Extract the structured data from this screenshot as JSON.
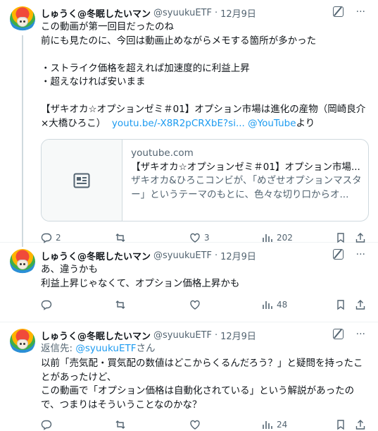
{
  "tweets": [
    {
      "name": "しゅうく@冬眠したいマン",
      "handle": "@syuukuETF",
      "dot": "·",
      "time": "12月9日",
      "text": "この動画が第一回目だったのね\n前にも見たのに、今回は動画止めながらメモする箇所が多かった\n\n・ストライク価格を超えれば加速度的に利益上昇\n・超えなければ安いまま\n\n【ザキオカ☆オプションゼミ＃01】オプション市場は進化の産物（岡崎良介×大橋ひろこ）",
      "link1": "youtu.be/-X8R2pCRXbE?si...",
      "link2": "@YouTube",
      "tail": "より",
      "card": {
        "domain": "youtube.com",
        "title": "【ザキオカ☆オプションゼミ＃01】オプション市場...",
        "desc": "ザキオカ&ひろこコンビが、「めざせオプションマスター」というテーマのもとに、色々な切り口からオ..."
      },
      "replies": "2",
      "retweets": "",
      "likes": "3",
      "views": "202"
    },
    {
      "name": "しゅうく@冬眠したいマン",
      "handle": "@syuukuETF",
      "dot": "·",
      "time": "12月9日",
      "text": "あ、違うかも\n利益上昇じゃなくて、オプション価格上昇かも",
      "replies": "",
      "retweets": "",
      "likes": "",
      "views": "48"
    },
    {
      "name": "しゅうく@冬眠したいマン",
      "handle": "@syuukuETF",
      "dot": "·",
      "time": "12月9日",
      "reply_prefix": "返信先: ",
      "reply_handle": "@syuukuETF",
      "reply_suffix": "さん",
      "text": "以前「売気配・買気配の数値はどこからくるんだろう？」と疑問を持ったことがあったけど、\nこの動画で「オプション価格は自動化されている」という解説があったので、つまりはそういうことなのかな？",
      "replies": "",
      "retweets": "",
      "likes": "",
      "views": "24"
    }
  ],
  "colors": {
    "accent": "#1d9bf0",
    "muted": "#536471",
    "text": "#0f1419",
    "border": "#cfd9de"
  }
}
